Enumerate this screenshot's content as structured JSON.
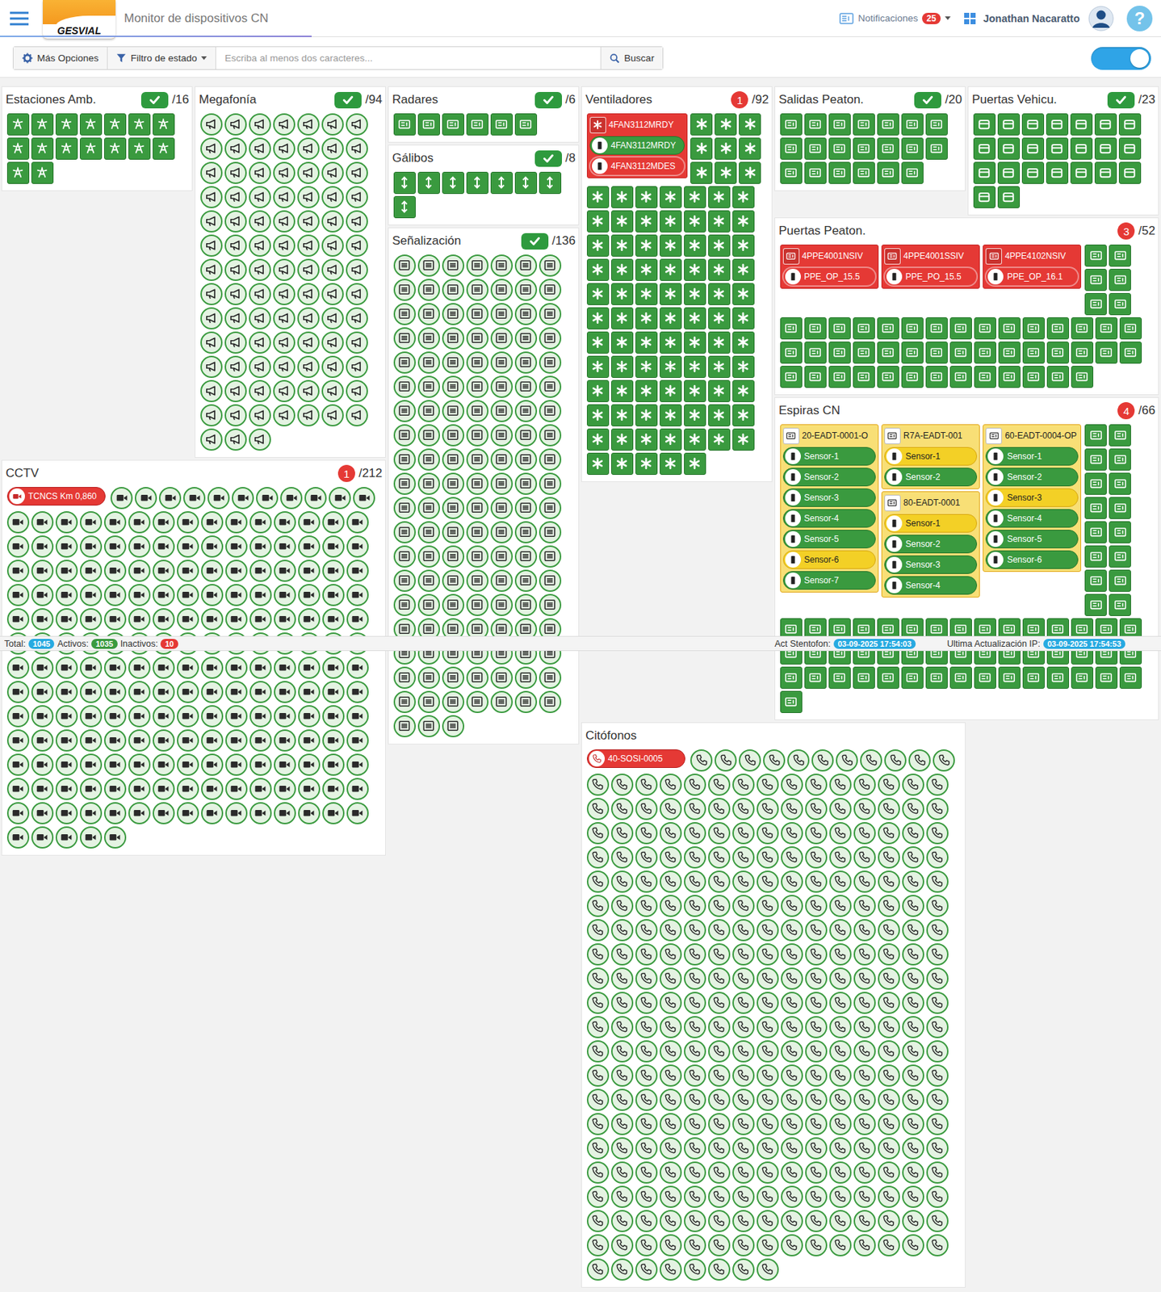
{
  "app": {
    "logo": "GESVIAL",
    "title": "Monitor de dispositivos CN"
  },
  "header": {
    "notifications": {
      "label": "Notificaciones",
      "count": "25"
    },
    "user": "Jonathan Nacaratto",
    "help": "?"
  },
  "toolbar": {
    "options": "Más Opciones",
    "filter": "Filtro de estado",
    "search_placeholder": "Escriba al menos dos caracteres...",
    "search_button": "Buscar",
    "toggle_on": true
  },
  "panels": {
    "estaciones": {
      "title": "Estaciones Amb.",
      "kind": "weather",
      "badge": {
        "kind": "ok"
      },
      "total": "/16",
      "ok_devices": 16,
      "alerts": []
    },
    "megafonia": {
      "title": "Megafonía",
      "kind": "megaphone",
      "badge": {
        "kind": "ok"
      },
      "total": "/94",
      "ok_devices": 94,
      "alerts": []
    },
    "radares": {
      "title": "Radares",
      "kind": "device",
      "badge": {
        "kind": "ok"
      },
      "total": "/6",
      "ok_devices": 6,
      "alerts": []
    },
    "galibos": {
      "title": "Gálibos",
      "kind": "galibo",
      "badge": {
        "kind": "ok"
      },
      "total": "/8",
      "ok_devices": 8,
      "alerts": []
    },
    "senalizacion": {
      "title": "Señalización",
      "kind": "signal",
      "badge": {
        "kind": "ok"
      },
      "total": "/136",
      "ok_devices": 136,
      "alerts": []
    },
    "ventiladores": {
      "title": "Ventiladores",
      "kind": "fan",
      "badge": {
        "kind": "alarm",
        "count": "1"
      },
      "total": "/92",
      "ok_devices": 91,
      "alerts": [
        {
          "label": "4FAN3112MRDY",
          "status": "error",
          "children": [
            {
              "label": "4FAN3112MRDY",
              "status": "ok"
            },
            {
              "label": "4FAN3112MDES",
              "status": "error"
            }
          ]
        }
      ]
    },
    "salidas": {
      "title": "Salidas Peaton.",
      "kind": "device",
      "badge": {
        "kind": "ok"
      },
      "total": "/20",
      "ok_devices": 20,
      "alerts": []
    },
    "puertas_vehic": {
      "title": "Puertas Vehicu.",
      "kind": "door",
      "badge": {
        "kind": "ok"
      },
      "total": "/23",
      "ok_devices": 23,
      "alerts": []
    },
    "puertas_peaton": {
      "title": "Puertas Peaton.",
      "kind": "device",
      "badge": {
        "kind": "alarm",
        "count": "3"
      },
      "total": "/52",
      "ok_devices": 49,
      "alerts": [
        {
          "label": "4PPE4001NSIV",
          "status": "error",
          "children": [
            {
              "label": "PPE_OP_15.5",
              "status": "error"
            }
          ]
        },
        {
          "label": "4PPE4001SSIV",
          "status": "error",
          "children": [
            {
              "label": "PPE_PO_15.5",
              "status": "error"
            }
          ]
        },
        {
          "label": "4PPE4102NSIV",
          "status": "error",
          "children": [
            {
              "label": "PPE_OP_16.1",
              "status": "error"
            }
          ]
        }
      ]
    },
    "espiras": {
      "title": "Espiras CN",
      "kind": "device",
      "badge": {
        "kind": "alarm",
        "count": "4"
      },
      "total": "/66",
      "ok_devices": 62,
      "alerts": [
        {
          "label": "20-EADT-0001-O",
          "status": "warning",
          "children": [
            {
              "label": "Sensor-1",
              "status": "ok"
            },
            {
              "label": "Sensor-2",
              "status": "ok"
            },
            {
              "label": "Sensor-3",
              "status": "ok"
            },
            {
              "label": "Sensor-4",
              "status": "ok"
            },
            {
              "label": "Sensor-5",
              "status": "ok"
            },
            {
              "label": "Sensor-6",
              "status": "warning"
            },
            {
              "label": "Sensor-7",
              "status": "ok"
            }
          ]
        },
        {
          "label": "R7A-EADT-001",
          "status": "warning",
          "children": [
            {
              "label": "Sensor-1",
              "status": "warning"
            },
            {
              "label": "Sensor-2",
              "status": "ok"
            }
          ]
        },
        {
          "label": "80-EADT-0001",
          "status": "warning",
          "children": [
            {
              "label": "Sensor-1",
              "status": "warning"
            },
            {
              "label": "Sensor-2",
              "status": "ok"
            },
            {
              "label": "Sensor-3",
              "status": "ok"
            },
            {
              "label": "Sensor-4",
              "status": "ok"
            }
          ]
        },
        {
          "label": "60-EADT-0004-OP",
          "status": "warning",
          "children": [
            {
              "label": "Sensor-1",
              "status": "ok"
            },
            {
              "label": "Sensor-2",
              "status": "ok"
            },
            {
              "label": "Sensor-3",
              "status": "warning"
            },
            {
              "label": "Sensor-4",
              "status": "ok"
            },
            {
              "label": "Sensor-5",
              "status": "ok"
            },
            {
              "label": "Sensor-6",
              "status": "ok"
            }
          ]
        }
      ]
    },
    "cctv": {
      "title": "CCTV",
      "kind": "camera",
      "badge": {
        "kind": "alarm",
        "count": "1"
      },
      "total": "/212",
      "ok_devices": 211,
      "alerts": [
        {
          "label": "TCNCS Km 0,860",
          "status": "error"
        }
      ]
    },
    "citofonos": {
      "title": "Citófonos",
      "kind": "phone",
      "badge": null,
      "total": "",
      "ok_devices": 319,
      "alerts": [
        {
          "label": "40-SOSI-0005",
          "status": "error"
        }
      ]
    }
  },
  "status_bar": {
    "total_label": "Total:",
    "total": "1045",
    "active_label": "Activos:",
    "active": "1035",
    "inactive_label": "Inactivos:",
    "inactive": "10",
    "stentofon_label": "Act Stentofon:",
    "stentofon": "03-09-2025 17:54:03",
    "ip_label": "Ultima Actualización IP:",
    "ip": "03-09-2025 17:54:53"
  }
}
